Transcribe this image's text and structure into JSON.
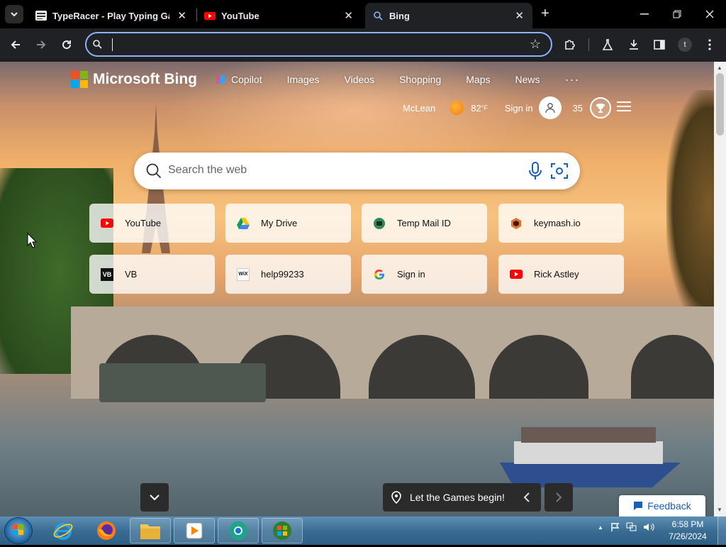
{
  "tabs": [
    {
      "title": "TypeRacer - Play Typing Games",
      "icon": "typeracer-icon",
      "active": false
    },
    {
      "title": "YouTube",
      "icon": "youtube-icon",
      "active": false
    },
    {
      "title": "Bing",
      "icon": "bing-search-icon",
      "active": true
    }
  ],
  "tab_close_glyph": "✕",
  "new_tab_glyph": "+",
  "window_controls": {
    "minimize": "—",
    "maximize": "❐",
    "close": "✕"
  },
  "omnibox": {
    "value": "",
    "placeholder": ""
  },
  "profile_initial": "t",
  "bing": {
    "logo_text": "Microsoft Bing",
    "nav": [
      "Copilot",
      "Images",
      "Videos",
      "Shopping",
      "Maps",
      "News"
    ],
    "more": "···",
    "location": "McLean",
    "temperature": "82",
    "temp_unit": "°F",
    "sign_in": "Sign in",
    "rewards_points": "35",
    "search_placeholder": "Search the web",
    "tiles": [
      {
        "label": "YouTube",
        "icon": "youtube-icon"
      },
      {
        "label": "My Drive",
        "icon": "google-drive-icon"
      },
      {
        "label": "Temp Mail ID",
        "icon": "temp-mail-icon"
      },
      {
        "label": "keymash.io",
        "icon": "keymash-icon"
      },
      {
        "label": "VB",
        "icon": "vb-icon",
        "icon_text": "VB"
      },
      {
        "label": "help99233",
        "icon": "wix-icon",
        "icon_text": "WiX"
      },
      {
        "label": "Sign in",
        "icon": "google-icon"
      },
      {
        "label": "Rick Astley",
        "icon": "youtube-icon"
      }
    ],
    "info_text": "Let the Games begin!",
    "feedback": "Feedback"
  },
  "taskbar": {
    "apps": [
      "internet-explorer-icon",
      "firefox-icon",
      "file-explorer-icon",
      "media-player-icon",
      "chrome-icon",
      "windows-explorer-icon"
    ],
    "time": "6:58 PM",
    "date": "7/26/2024",
    "tray_chevron": "▲"
  },
  "colors": {
    "accent": "#8ab4f8",
    "chrome_bg": "#202124",
    "feedback_text": "#1a5fb4"
  }
}
